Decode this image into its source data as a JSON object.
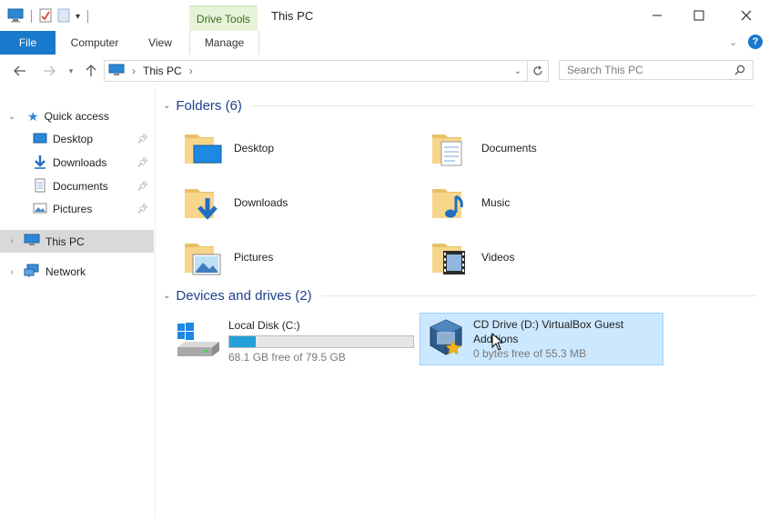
{
  "window": {
    "title": "This PC",
    "context_tab": "Drive Tools",
    "minimize": "—",
    "maximize": "☐",
    "close": "✕"
  },
  "ribbon": {
    "tabs": [
      {
        "label": "File"
      },
      {
        "label": "Computer"
      },
      {
        "label": "View"
      },
      {
        "label": "Manage"
      }
    ],
    "help": "?"
  },
  "address": {
    "path_root": "This PC",
    "separator": "›",
    "search_placeholder": "Search This PC"
  },
  "nav": {
    "quick_access": "Quick access",
    "items": [
      {
        "label": "Desktop"
      },
      {
        "label": "Downloads"
      },
      {
        "label": "Documents"
      },
      {
        "label": "Pictures"
      }
    ],
    "this_pc": "This PC",
    "network": "Network"
  },
  "folders": {
    "heading": "Folders (6)",
    "items": [
      {
        "label": "Desktop"
      },
      {
        "label": "Documents"
      },
      {
        "label": "Downloads"
      },
      {
        "label": "Music"
      },
      {
        "label": "Pictures"
      },
      {
        "label": "Videos"
      }
    ]
  },
  "drives": {
    "heading": "Devices and drives (2)",
    "items": [
      {
        "name": "Local Disk (C:)",
        "free": "68.1 GB free of 79.5 GB",
        "used_fraction": 0.143
      },
      {
        "name": "CD Drive (D:) VirtualBox Guest Additions",
        "free": "0 bytes free of 55.3 MB"
      }
    ]
  },
  "colors": {
    "file_tab": "#1979ca",
    "accent": "#26a0da",
    "selection": "#cce8ff",
    "section_heading": "#1e3f8a"
  }
}
